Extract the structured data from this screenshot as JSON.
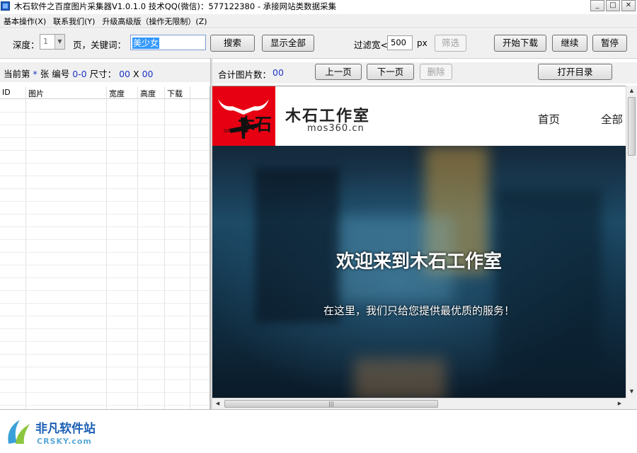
{
  "window": {
    "title": "木石软件之百度图片采集器V1.0.1.0  技术QQ(微信)：577122380   - 承接网站类数据采集",
    "buttons": [
      "_",
      "□",
      "✕"
    ]
  },
  "menu": [
    "基本操作(X)",
    "联系我们(Y)",
    "升级高级版（操作无限制）(Z)"
  ],
  "toolbar": {
    "depth_label": "深度：",
    "depth_value": "1",
    "page_label": "页，关键词：",
    "keyword_value": "美少女",
    "search_button": "搜索",
    "show_all_button": "显示全部",
    "filter_label": "过滤宽<",
    "filter_value": "500",
    "filter_unit": "px",
    "filter_button": "筛选",
    "start_button": "开始下载",
    "continue_button": "继续",
    "pause_button": "暂停"
  },
  "info": {
    "current_label": "当前第",
    "current_value": "*",
    "number_label": "张 编号",
    "number_value": "0-0",
    "size_label": "尺寸：",
    "width_value": "00",
    "x_label": "X",
    "height_value": "00",
    "total_label": "合计图片数：",
    "total_value": "00",
    "prev_button": "上一页",
    "next_button": "下一页",
    "delete_button": "删除",
    "open_dir_button": "打开目录"
  },
  "table": {
    "columns": [
      "ID",
      "图片",
      "宽度",
      "高度",
      "下载"
    ],
    "rows": []
  },
  "browser": {
    "brand_name": "木石工作室",
    "brand_url": "mos360.cn",
    "logo_text": "木石",
    "logo_small": "SINCE 2009",
    "nav": [
      "首页",
      "全部"
    ],
    "hero_title": "欢迎来到木石工作室",
    "hero_subtitle": "在这里，我们只给您提供最优质的服务！"
  },
  "watermark": {
    "name": "非凡软件站",
    "domain": "CRSKY.com"
  },
  "colors": {
    "accent_blue": "#1c34c8",
    "logo_red": "#e60012",
    "selection": "#3399ff"
  }
}
